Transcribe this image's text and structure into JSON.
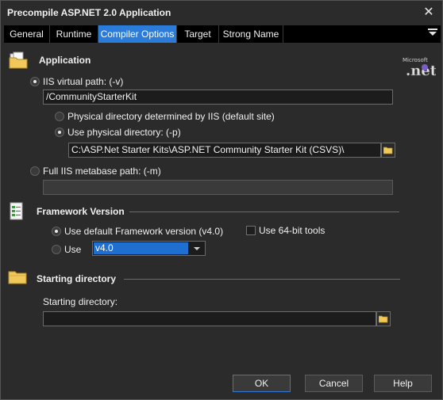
{
  "window": {
    "title": "Precompile ASP.NET 2.0 Application",
    "close_glyph": "✕"
  },
  "tabs": [
    {
      "label": "General",
      "active": false
    },
    {
      "label": "Runtime",
      "active": false
    },
    {
      "label": "Compiler Options",
      "active": true
    },
    {
      "label": "Target",
      "active": false
    },
    {
      "label": "Strong Name",
      "active": false
    }
  ],
  "application": {
    "title": "Application",
    "iis_virtual_path": {
      "label": "IIS virtual path: (-v)",
      "checked": true,
      "value": "/CommunityStarterKit"
    },
    "physical_by_iis": {
      "label": "Physical directory determined by IIS (default site)",
      "checked": false
    },
    "use_physical": {
      "label": "Use physical directory: (-p)",
      "checked": true,
      "value": "C:\\ASP.Net Starter Kits\\ASP.NET Community Starter Kit (CSVS)\\"
    },
    "full_iis_metabase": {
      "label": "Full IIS metabase path: (-m)",
      "checked": false,
      "value": ""
    }
  },
  "framework": {
    "title": "Framework Version",
    "use_default": {
      "label": "Use default Framework version (v4.0)",
      "checked": true
    },
    "use_64bit": {
      "label": "Use 64-bit tools",
      "checked": false
    },
    "use_version": {
      "label": "Use",
      "checked": false,
      "selected": "v4.0"
    }
  },
  "starting": {
    "title": "Starting directory",
    "field_label": "Starting directory:",
    "value": ""
  },
  "buttons": {
    "ok": "OK",
    "cancel": "Cancel",
    "help": "Help"
  },
  "icons": {
    "application": "folder-document-icon",
    "net_logo": "net-logo-icon",
    "framework": "framework-document-icon",
    "starting": "folder-icon",
    "browse": "open-folder-icon",
    "tab_menu": "menu-dropdown-icon"
  },
  "colors": {
    "accent": "#2b7bd8",
    "background": "#2b2b2b",
    "tabbar": "#000000"
  }
}
